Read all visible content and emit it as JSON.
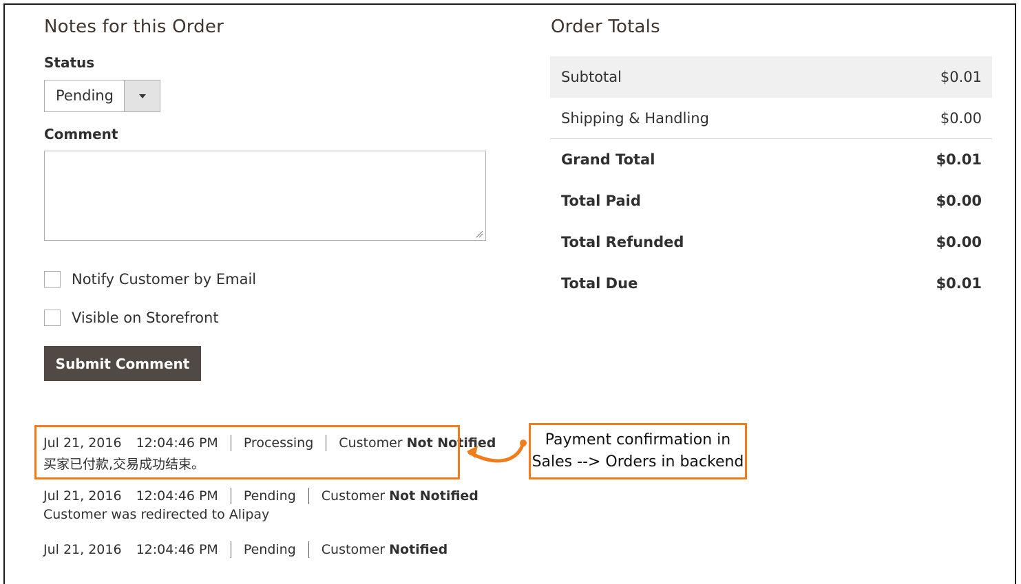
{
  "notes": {
    "title": "Notes for this Order",
    "status_label": "Status",
    "status_value": "Pending",
    "comment_label": "Comment",
    "comment_value": "",
    "notify_label": "Notify Customer by Email",
    "visible_label": "Visible on Storefront",
    "submit_label": "Submit Comment"
  },
  "totals": {
    "title": "Order Totals",
    "rows": [
      {
        "label": "Subtotal",
        "value": "$0.01"
      },
      {
        "label": "Shipping & Handling",
        "value": "$0.00"
      },
      {
        "label": "Grand Total",
        "value": "$0.01"
      },
      {
        "label": "Total Paid",
        "value": "$0.00"
      },
      {
        "label": "Total Refunded",
        "value": "$0.00"
      },
      {
        "label": "Total Due",
        "value": "$0.01"
      }
    ]
  },
  "history": [
    {
      "date": "Jul 21, 2016",
      "time": "12:04:46 PM",
      "status": "Processing",
      "customer_prefix": "Customer",
      "customer_state": "Not Notified",
      "comment": "买家已付款,交易成功结束。"
    },
    {
      "date": "Jul 21, 2016",
      "time": "12:04:46 PM",
      "status": "Pending",
      "customer_prefix": "Customer",
      "customer_state": "Not Notified",
      "comment": "Customer was redirected to Alipay"
    },
    {
      "date": "Jul 21, 2016",
      "time": "12:04:46 PM",
      "status": "Pending",
      "customer_prefix": "Customer",
      "customer_state": "Notified",
      "comment": ""
    }
  ],
  "annotation": {
    "line1": "Payment confirmation in",
    "line2": "Sales --> Orders in backend"
  },
  "colors": {
    "accent_orange": "#f07c1c",
    "button_bg": "#514943",
    "shaded_row": "#f0f0f0"
  }
}
